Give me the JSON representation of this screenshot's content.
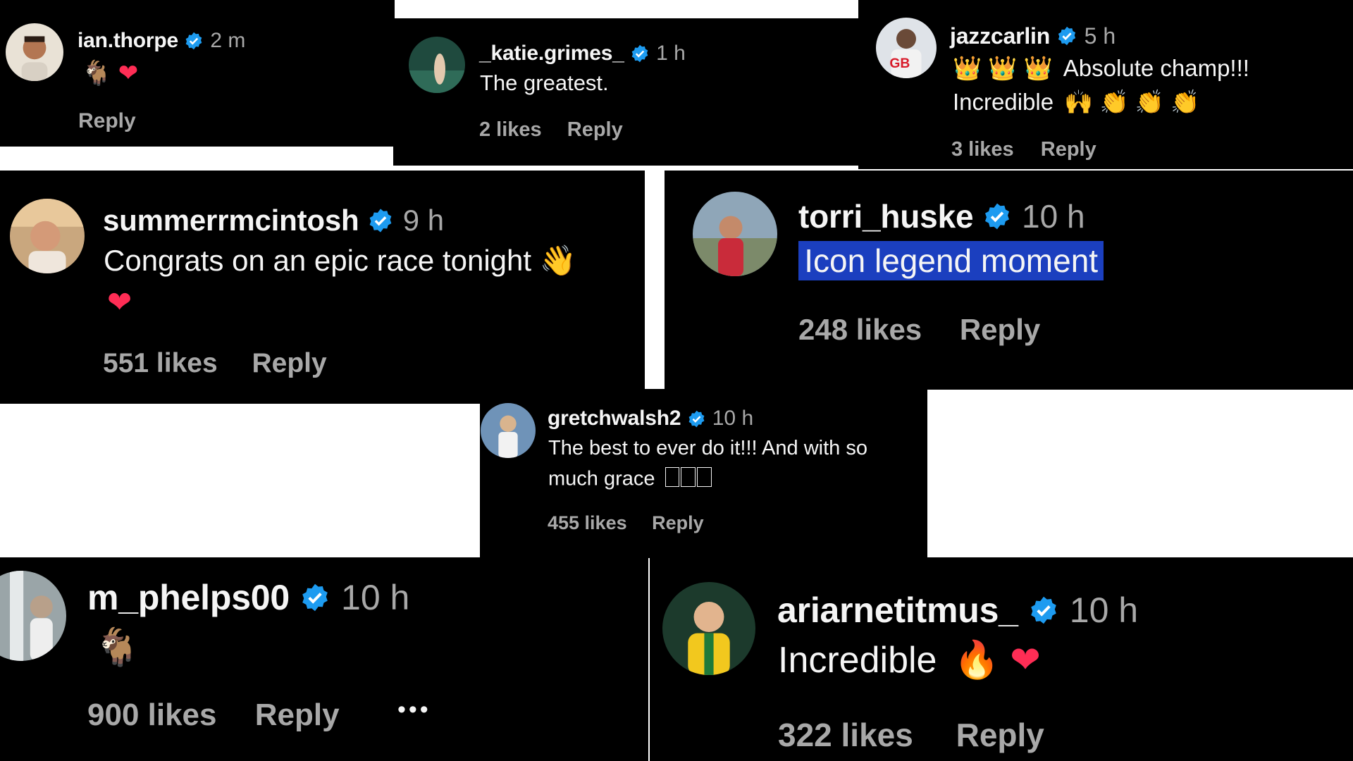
{
  "colors": {
    "background": "#000000",
    "username": "#f5f5f5",
    "muted": "#a8a8a8",
    "verified": "#1d9bf0",
    "highlight": "#1b3fbf"
  },
  "comments": [
    {
      "username": "ian.thorpe",
      "verified": true,
      "time": "2 m",
      "text": "",
      "emojis": [
        "goat-emoji",
        "red-heart-emoji"
      ],
      "likes": "",
      "reply": "Reply"
    },
    {
      "username": "_katie.grimes_",
      "verified": true,
      "time": "1 h",
      "text": "The greatest.",
      "likes": "2 likes",
      "reply": "Reply"
    },
    {
      "username": "jazzcarlin",
      "verified": true,
      "time": "5 h",
      "text_line1": "Absolute champ!!!",
      "text_line2": "Incredible",
      "emojis_line1": [
        "crown-emoji",
        "crown-emoji",
        "crown-emoji"
      ],
      "emojis_line2": [
        "raising-hands-emoji",
        "clapping-hands-emoji",
        "clapping-hands-emoji",
        "clapping-hands-emoji"
      ],
      "likes": "3 likes",
      "reply": "Reply"
    },
    {
      "username": "summerrmcintosh",
      "verified": true,
      "time": "9 h",
      "text": "Congrats on an epic race tonight",
      "emojis": [
        "waving-hand-emoji",
        "red-heart-emoji"
      ],
      "likes": "551 likes",
      "reply": "Reply"
    },
    {
      "username": "torri_huske",
      "verified": true,
      "time": "10 h",
      "text": "Icon legend moment",
      "selected": true,
      "likes": "248 likes",
      "reply": "Reply"
    },
    {
      "username": "gretchwalsh2",
      "verified": true,
      "time": "10 h",
      "text_line1": "The best to ever do it!!! And with so",
      "text_line2": "much grace",
      "missing_glyph_count": 3,
      "likes": "455 likes",
      "reply": "Reply"
    },
    {
      "username": "m_phelps00",
      "verified": true,
      "time": "10 h",
      "text": "",
      "emojis": [
        "goat-emoji"
      ],
      "likes": "900 likes",
      "reply": "Reply",
      "more": "•••"
    },
    {
      "username": "ariarnetitmus_",
      "verified": true,
      "time": "10 h",
      "text": "Incredible",
      "emojis": [
        "fire-emoji",
        "red-heart-emoji"
      ],
      "likes": "322 likes",
      "reply": "Reply"
    }
  ]
}
